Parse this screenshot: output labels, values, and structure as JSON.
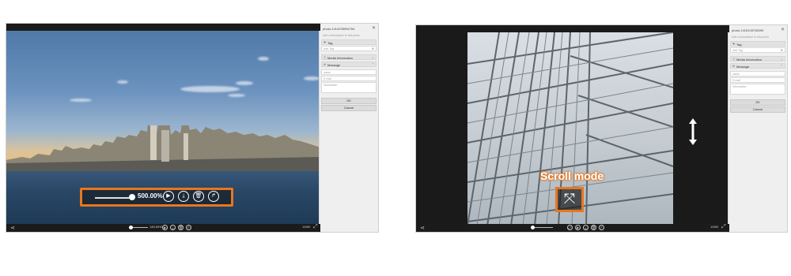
{
  "left_window": {
    "panel": {
      "title": "photo-1414235994764",
      "description_placeholder": "Add a description to this photo",
      "sections": {
        "tag": "Tag",
        "media_info": "Media Information",
        "message": "Message"
      },
      "tag_placeholder": "Add Tag",
      "fields": {
        "name": "name",
        "email": "E-mail",
        "info": "Information"
      },
      "ok_label": "OK",
      "cancel_label": "Cancel"
    },
    "controls": {
      "zoom_label": "500.00%",
      "small_zoom_label": "145.00%",
      "counter": "19/89"
    }
  },
  "right_window": {
    "panel": {
      "title": "photo-1415105735099",
      "description_placeholder": "Add a description to this photo",
      "sections": {
        "tag": "Tag",
        "media_info": "Media Information",
        "message": "Message"
      },
      "tag_placeholder": "Add Tag",
      "fields": {
        "name": "name",
        "email": "E-mail",
        "info": "Information"
      },
      "ok_label": "OK",
      "cancel_label": "Cancel"
    },
    "overlay": {
      "scroll_mode_label": "Scroll mode"
    },
    "controls": {
      "counter": "19/89"
    }
  },
  "icons": {
    "play": "▶",
    "download": "⤓",
    "trash": "🗑",
    "rotate": "↱",
    "share": "⋖",
    "expand": "⤢",
    "close": "✕",
    "scroll-mode": "⤧"
  },
  "colors": {
    "highlight": "#e8771e"
  }
}
